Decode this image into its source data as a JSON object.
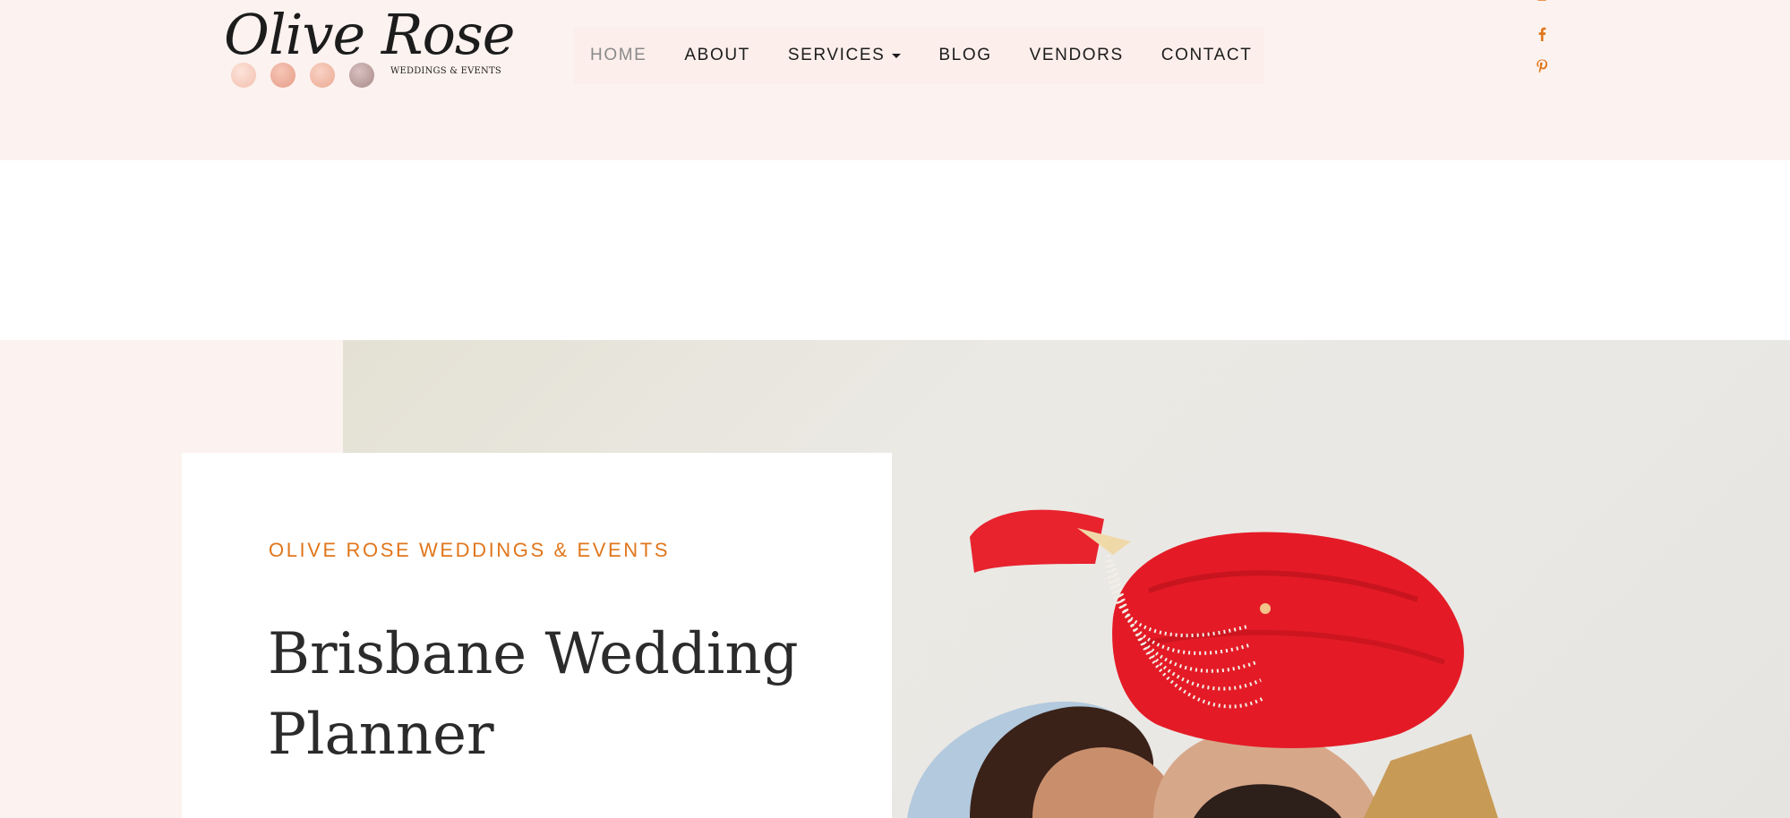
{
  "brand": {
    "name": "Olive Rose",
    "tagline": "WEDDINGS & EVENTS",
    "dot_colors": [
      "#f5c9bd",
      "#eeab9a",
      "#f1b8a6",
      "#b89a9a"
    ]
  },
  "nav": {
    "items": [
      {
        "label": "HOME",
        "active": true
      },
      {
        "label": "ABOUT"
      },
      {
        "label": "SERVICES",
        "has_dropdown": true
      },
      {
        "label": "BLOG"
      },
      {
        "label": "VENDORS"
      },
      {
        "label": "CONTACT"
      }
    ]
  },
  "social": {
    "icons": [
      "facebook-icon",
      "pinterest-icon"
    ],
    "color": "#e0761c"
  },
  "hero": {
    "eyebrow": "OLIVE ROSE WEDDINGS & EVENTS",
    "title": "Brisbane Wedding Planner"
  },
  "colors": {
    "header_bg": "#fcf2ef",
    "accent": "#e0761c",
    "text_dark": "#1c1c1c",
    "nav_active": "#8a8a8a"
  }
}
